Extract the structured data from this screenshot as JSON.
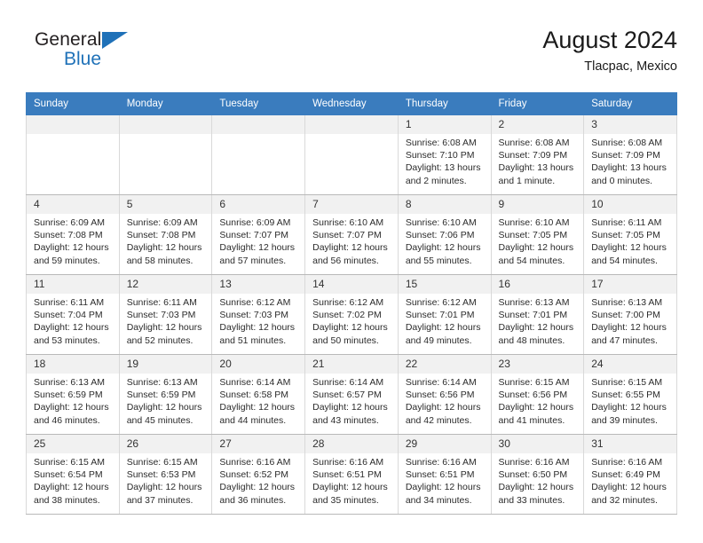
{
  "brand": {
    "name_part1": "General",
    "name_part2": "Blue",
    "logo_icon": "triangle-logo-icon"
  },
  "header": {
    "title": "August 2024",
    "subtitle": "Tlacpac, Mexico"
  },
  "colors": {
    "header_blue": "#3a7cbe",
    "brand_blue": "#1f71b8",
    "daynum_bg": "#f1f1f1",
    "cell_border": "#d9d9d9",
    "row_border": "#b9b9b9",
    "text": "#2b2b2b"
  },
  "weekdays": [
    "Sunday",
    "Monday",
    "Tuesday",
    "Wednesday",
    "Thursday",
    "Friday",
    "Saturday"
  ],
  "weeks": [
    [
      {
        "day": "",
        "empty": true,
        "sunrise": "",
        "sunset": "",
        "daylight1": "",
        "daylight2": ""
      },
      {
        "day": "",
        "empty": true,
        "sunrise": "",
        "sunset": "",
        "daylight1": "",
        "daylight2": ""
      },
      {
        "day": "",
        "empty": true,
        "sunrise": "",
        "sunset": "",
        "daylight1": "",
        "daylight2": ""
      },
      {
        "day": "",
        "empty": true,
        "sunrise": "",
        "sunset": "",
        "daylight1": "",
        "daylight2": ""
      },
      {
        "day": "1",
        "empty": false,
        "sunrise": "Sunrise: 6:08 AM",
        "sunset": "Sunset: 7:10 PM",
        "daylight1": "Daylight: 13 hours",
        "daylight2": "and 2 minutes."
      },
      {
        "day": "2",
        "empty": false,
        "sunrise": "Sunrise: 6:08 AM",
        "sunset": "Sunset: 7:09 PM",
        "daylight1": "Daylight: 13 hours",
        "daylight2": "and 1 minute."
      },
      {
        "day": "3",
        "empty": false,
        "sunrise": "Sunrise: 6:08 AM",
        "sunset": "Sunset: 7:09 PM",
        "daylight1": "Daylight: 13 hours",
        "daylight2": "and 0 minutes."
      }
    ],
    [
      {
        "day": "4",
        "empty": false,
        "sunrise": "Sunrise: 6:09 AM",
        "sunset": "Sunset: 7:08 PM",
        "daylight1": "Daylight: 12 hours",
        "daylight2": "and 59 minutes."
      },
      {
        "day": "5",
        "empty": false,
        "sunrise": "Sunrise: 6:09 AM",
        "sunset": "Sunset: 7:08 PM",
        "daylight1": "Daylight: 12 hours",
        "daylight2": "and 58 minutes."
      },
      {
        "day": "6",
        "empty": false,
        "sunrise": "Sunrise: 6:09 AM",
        "sunset": "Sunset: 7:07 PM",
        "daylight1": "Daylight: 12 hours",
        "daylight2": "and 57 minutes."
      },
      {
        "day": "7",
        "empty": false,
        "sunrise": "Sunrise: 6:10 AM",
        "sunset": "Sunset: 7:07 PM",
        "daylight1": "Daylight: 12 hours",
        "daylight2": "and 56 minutes."
      },
      {
        "day": "8",
        "empty": false,
        "sunrise": "Sunrise: 6:10 AM",
        "sunset": "Sunset: 7:06 PM",
        "daylight1": "Daylight: 12 hours",
        "daylight2": "and 55 minutes."
      },
      {
        "day": "9",
        "empty": false,
        "sunrise": "Sunrise: 6:10 AM",
        "sunset": "Sunset: 7:05 PM",
        "daylight1": "Daylight: 12 hours",
        "daylight2": "and 54 minutes."
      },
      {
        "day": "10",
        "empty": false,
        "sunrise": "Sunrise: 6:11 AM",
        "sunset": "Sunset: 7:05 PM",
        "daylight1": "Daylight: 12 hours",
        "daylight2": "and 54 minutes."
      }
    ],
    [
      {
        "day": "11",
        "empty": false,
        "sunrise": "Sunrise: 6:11 AM",
        "sunset": "Sunset: 7:04 PM",
        "daylight1": "Daylight: 12 hours",
        "daylight2": "and 53 minutes."
      },
      {
        "day": "12",
        "empty": false,
        "sunrise": "Sunrise: 6:11 AM",
        "sunset": "Sunset: 7:03 PM",
        "daylight1": "Daylight: 12 hours",
        "daylight2": "and 52 minutes."
      },
      {
        "day": "13",
        "empty": false,
        "sunrise": "Sunrise: 6:12 AM",
        "sunset": "Sunset: 7:03 PM",
        "daylight1": "Daylight: 12 hours",
        "daylight2": "and 51 minutes."
      },
      {
        "day": "14",
        "empty": false,
        "sunrise": "Sunrise: 6:12 AM",
        "sunset": "Sunset: 7:02 PM",
        "daylight1": "Daylight: 12 hours",
        "daylight2": "and 50 minutes."
      },
      {
        "day": "15",
        "empty": false,
        "sunrise": "Sunrise: 6:12 AM",
        "sunset": "Sunset: 7:01 PM",
        "daylight1": "Daylight: 12 hours",
        "daylight2": "and 49 minutes."
      },
      {
        "day": "16",
        "empty": false,
        "sunrise": "Sunrise: 6:13 AM",
        "sunset": "Sunset: 7:01 PM",
        "daylight1": "Daylight: 12 hours",
        "daylight2": "and 48 minutes."
      },
      {
        "day": "17",
        "empty": false,
        "sunrise": "Sunrise: 6:13 AM",
        "sunset": "Sunset: 7:00 PM",
        "daylight1": "Daylight: 12 hours",
        "daylight2": "and 47 minutes."
      }
    ],
    [
      {
        "day": "18",
        "empty": false,
        "sunrise": "Sunrise: 6:13 AM",
        "sunset": "Sunset: 6:59 PM",
        "daylight1": "Daylight: 12 hours",
        "daylight2": "and 46 minutes."
      },
      {
        "day": "19",
        "empty": false,
        "sunrise": "Sunrise: 6:13 AM",
        "sunset": "Sunset: 6:59 PM",
        "daylight1": "Daylight: 12 hours",
        "daylight2": "and 45 minutes."
      },
      {
        "day": "20",
        "empty": false,
        "sunrise": "Sunrise: 6:14 AM",
        "sunset": "Sunset: 6:58 PM",
        "daylight1": "Daylight: 12 hours",
        "daylight2": "and 44 minutes."
      },
      {
        "day": "21",
        "empty": false,
        "sunrise": "Sunrise: 6:14 AM",
        "sunset": "Sunset: 6:57 PM",
        "daylight1": "Daylight: 12 hours",
        "daylight2": "and 43 minutes."
      },
      {
        "day": "22",
        "empty": false,
        "sunrise": "Sunrise: 6:14 AM",
        "sunset": "Sunset: 6:56 PM",
        "daylight1": "Daylight: 12 hours",
        "daylight2": "and 42 minutes."
      },
      {
        "day": "23",
        "empty": false,
        "sunrise": "Sunrise: 6:15 AM",
        "sunset": "Sunset: 6:56 PM",
        "daylight1": "Daylight: 12 hours",
        "daylight2": "and 41 minutes."
      },
      {
        "day": "24",
        "empty": false,
        "sunrise": "Sunrise: 6:15 AM",
        "sunset": "Sunset: 6:55 PM",
        "daylight1": "Daylight: 12 hours",
        "daylight2": "and 39 minutes."
      }
    ],
    [
      {
        "day": "25",
        "empty": false,
        "sunrise": "Sunrise: 6:15 AM",
        "sunset": "Sunset: 6:54 PM",
        "daylight1": "Daylight: 12 hours",
        "daylight2": "and 38 minutes."
      },
      {
        "day": "26",
        "empty": false,
        "sunrise": "Sunrise: 6:15 AM",
        "sunset": "Sunset: 6:53 PM",
        "daylight1": "Daylight: 12 hours",
        "daylight2": "and 37 minutes."
      },
      {
        "day": "27",
        "empty": false,
        "sunrise": "Sunrise: 6:16 AM",
        "sunset": "Sunset: 6:52 PM",
        "daylight1": "Daylight: 12 hours",
        "daylight2": "and 36 minutes."
      },
      {
        "day": "28",
        "empty": false,
        "sunrise": "Sunrise: 6:16 AM",
        "sunset": "Sunset: 6:51 PM",
        "daylight1": "Daylight: 12 hours",
        "daylight2": "and 35 minutes."
      },
      {
        "day": "29",
        "empty": false,
        "sunrise": "Sunrise: 6:16 AM",
        "sunset": "Sunset: 6:51 PM",
        "daylight1": "Daylight: 12 hours",
        "daylight2": "and 34 minutes."
      },
      {
        "day": "30",
        "empty": false,
        "sunrise": "Sunrise: 6:16 AM",
        "sunset": "Sunset: 6:50 PM",
        "daylight1": "Daylight: 12 hours",
        "daylight2": "and 33 minutes."
      },
      {
        "day": "31",
        "empty": false,
        "sunrise": "Sunrise: 6:16 AM",
        "sunset": "Sunset: 6:49 PM",
        "daylight1": "Daylight: 12 hours",
        "daylight2": "and 32 minutes."
      }
    ]
  ]
}
